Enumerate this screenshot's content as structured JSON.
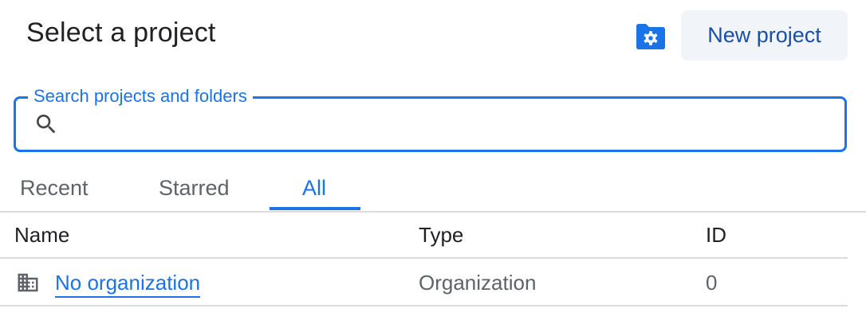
{
  "dialog": {
    "title": "Select a project",
    "new_project_label": "New project"
  },
  "search": {
    "label": "Search projects and folders",
    "value": "",
    "placeholder": ""
  },
  "tabs": [
    {
      "label": "Recent",
      "active": false
    },
    {
      "label": "Starred",
      "active": false
    },
    {
      "label": "All",
      "active": true
    }
  ],
  "table": {
    "columns": [
      "Name",
      "Type",
      "ID"
    ],
    "rows": [
      {
        "name": "No organization",
        "type": "Organization",
        "id": "0",
        "icon": "organization-icon"
      }
    ]
  },
  "colors": {
    "accent": "#1a73e8",
    "button_bg": "#f1f4f9",
    "button_text": "#1a4fa8",
    "divider": "#dadce0"
  },
  "icons": [
    "settings-folder-icon",
    "search-icon",
    "organization-icon"
  ]
}
